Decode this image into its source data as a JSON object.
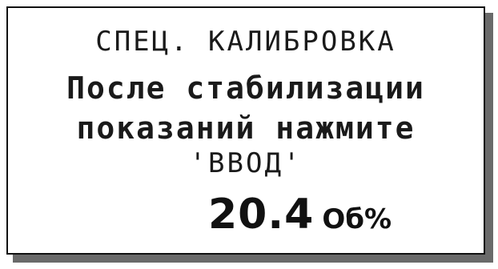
{
  "screen": {
    "title": "СПЕЦ. КАЛИБРОВКА",
    "message_line1": "После стабилизации",
    "message_line2": "показаний нажмите",
    "message_line3": "'ВВОД'",
    "reading": {
      "value": "20.4",
      "unit": "Об%"
    }
  }
}
